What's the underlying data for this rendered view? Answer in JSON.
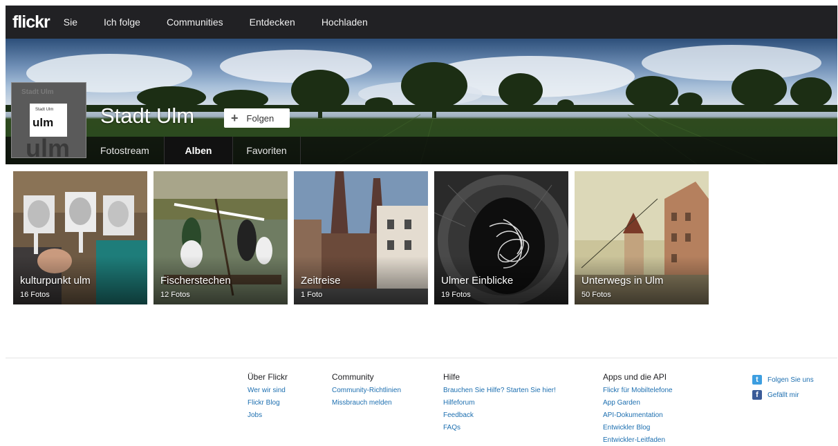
{
  "nav": {
    "logo": "flickr",
    "items": [
      "Sie",
      "Ich folge",
      "Communities",
      "Entdecken",
      "Hochladen"
    ]
  },
  "profile": {
    "name": "Stadt Ulm",
    "follow_label": "Folgen",
    "avatar_small_text": "Stadt Ulm",
    "avatar_logo_text": "ulm"
  },
  "subnav": {
    "tabs": [
      "Fotostream",
      "Alben",
      "Favoriten"
    ],
    "active": "Alben"
  },
  "albums": [
    {
      "title": "kulturpunkt ulm",
      "count": "16 Fotos"
    },
    {
      "title": "Fischerstechen",
      "count": "12 Fotos"
    },
    {
      "title": "Zeitreise",
      "count": "1 Foto"
    },
    {
      "title": "Ulmer Einblicke",
      "count": "19 Fotos"
    },
    {
      "title": "Unterwegs in Ulm",
      "count": "50 Fotos"
    }
  ],
  "footer": {
    "columns": [
      {
        "heading": "Über Flickr",
        "links": [
          "Wer wir sind",
          "Flickr Blog",
          "Jobs"
        ]
      },
      {
        "heading": "Community",
        "links": [
          "Community-Richtlinien",
          "Missbrauch melden"
        ]
      },
      {
        "heading": "Hilfe",
        "links": [
          "Brauchen Sie Hilfe? Starten Sie hier!",
          "Hilfeforum",
          "Feedback",
          "FAQs"
        ]
      },
      {
        "heading": "Apps und die API",
        "links": [
          "Flickr für Mobiltelefone",
          "App Garden",
          "API-Dokumentation",
          "Entwickler Blog",
          "Entwickler-Leitfaden"
        ]
      }
    ],
    "social": [
      {
        "icon": "twitter-icon",
        "label": "Folgen Sie uns"
      },
      {
        "icon": "facebook-icon",
        "label": "Gefällt mir"
      }
    ]
  },
  "colors": {
    "nav_bg": "#212124",
    "link": "#1d6fb0",
    "twitter": "#3d9ee0",
    "facebook": "#3b5b98"
  }
}
